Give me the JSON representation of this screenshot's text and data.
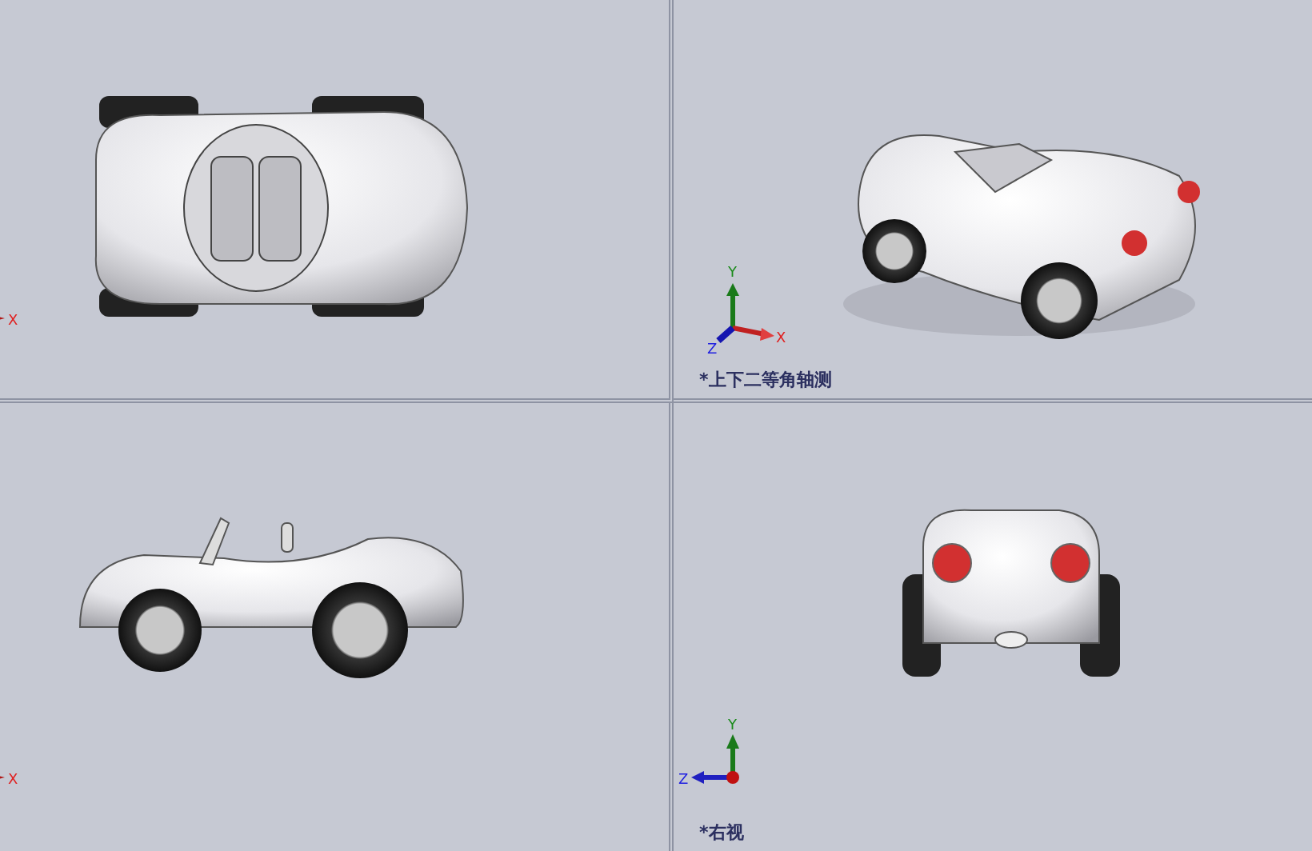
{
  "viewports": [
    {
      "kind": "top",
      "triad": {
        "kind": "edge-x",
        "labels": [
          "X"
        ]
      }
    },
    {
      "kind": "iso",
      "triad": {
        "kind": "iso",
        "labels": [
          "Y",
          "X",
          "Z"
        ]
      },
      "label": "*上下二等角轴测"
    },
    {
      "kind": "front",
      "triad": {
        "kind": "edge-x",
        "labels": [
          "X"
        ]
      }
    },
    {
      "kind": "right",
      "triad": {
        "kind": "yz",
        "labels": [
          "Y",
          "Z"
        ]
      },
      "label": "*右视"
    }
  ]
}
